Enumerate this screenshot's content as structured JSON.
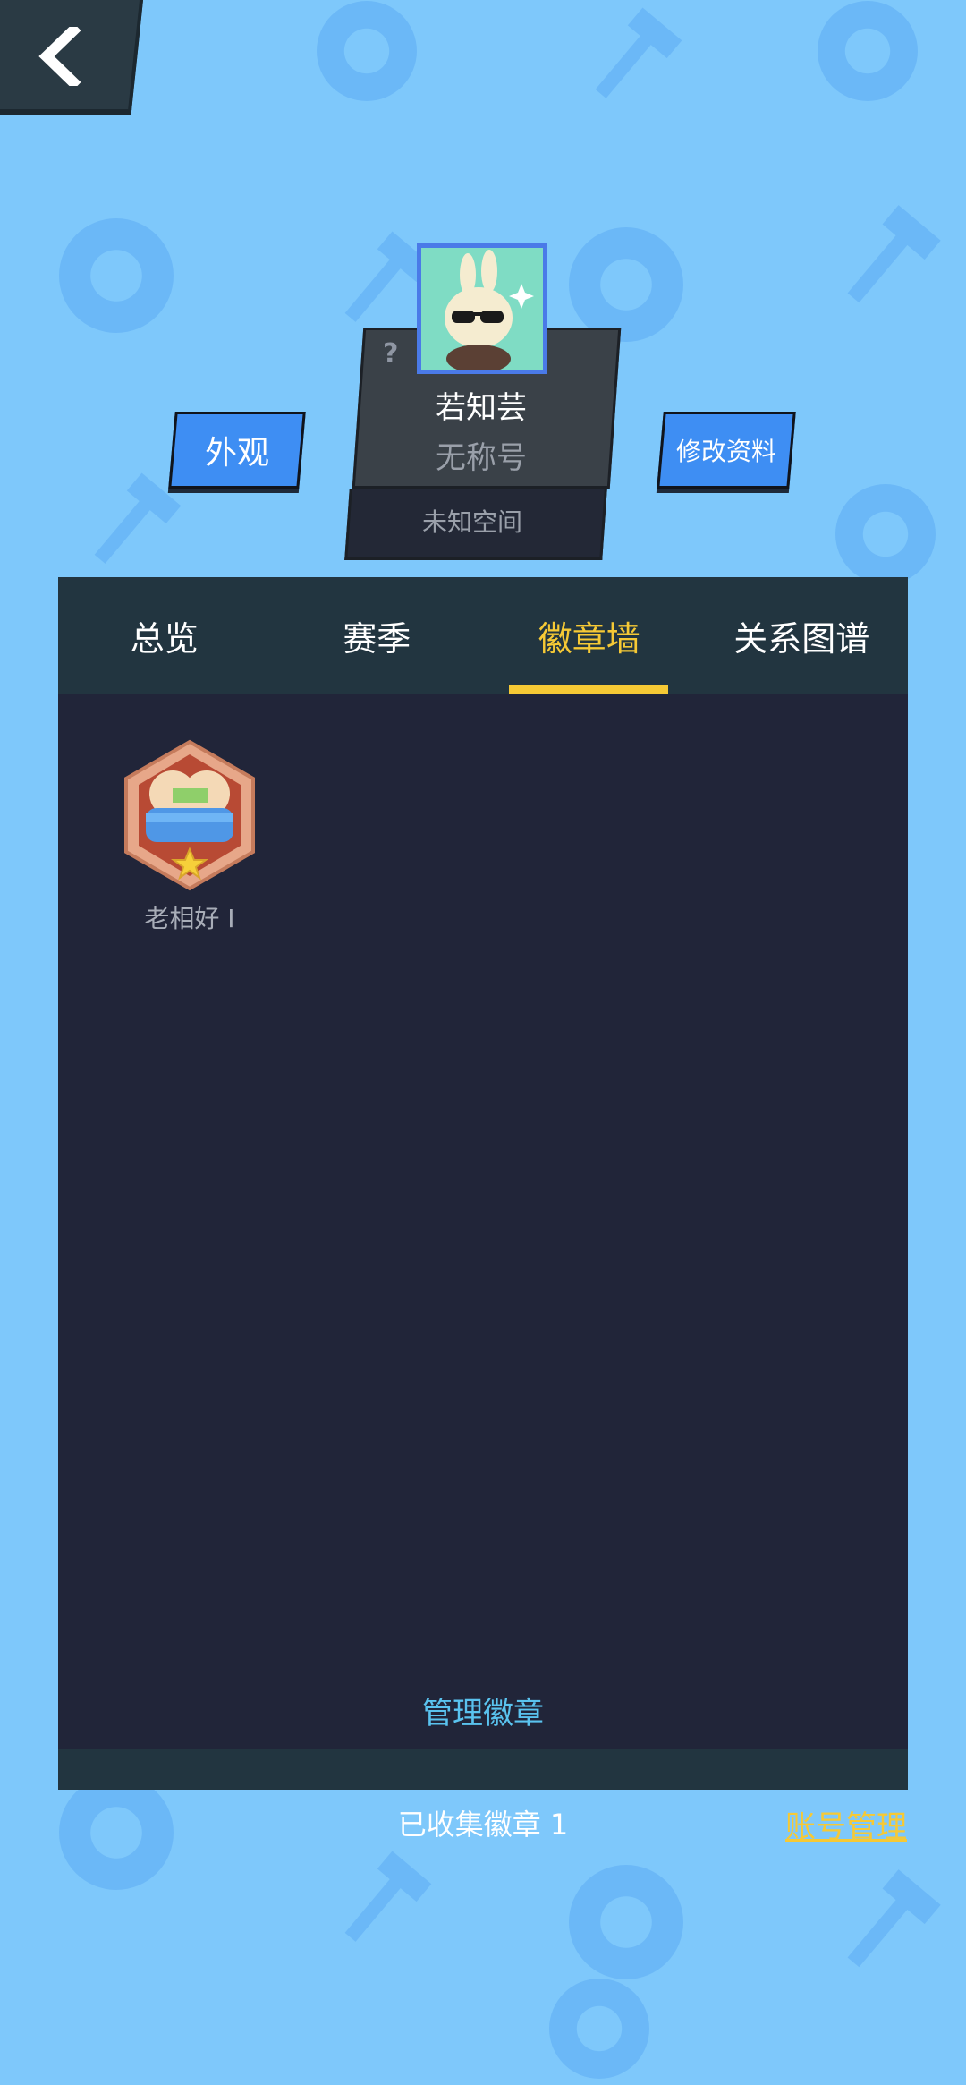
{
  "profile": {
    "name": "若知芸",
    "title": "无称号",
    "space": "未知空间",
    "question_mark": "?"
  },
  "buttons": {
    "appearance": "外观",
    "edit_profile": "修改资料"
  },
  "tabs": [
    {
      "label": "总览",
      "active": false
    },
    {
      "label": "赛季",
      "active": false
    },
    {
      "label": "徽章墙",
      "active": true
    },
    {
      "label": "关系图谱",
      "active": false
    }
  ],
  "badges": [
    {
      "label": "老相好 I",
      "icon": "couple-badge-icon"
    }
  ],
  "panel": {
    "manage_label": "管理徽章"
  },
  "footer": {
    "collected_label": "已收集徽章 1",
    "account_label": "账号管理"
  },
  "colors": {
    "background": "#7ec8fb",
    "panel": "#212539",
    "accent_yellow": "#f6c935",
    "link_blue": "#5ac3ef",
    "button_blue": "#3e8ef3"
  }
}
